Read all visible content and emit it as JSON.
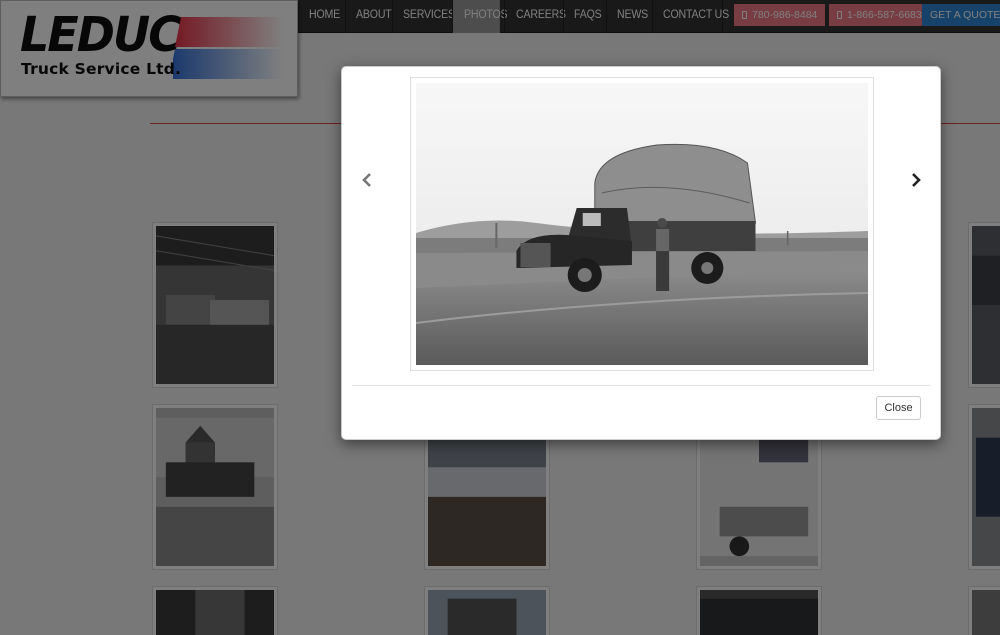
{
  "brand": {
    "logo_word": "LEDUC",
    "logo_sub": "Truck Service Ltd.",
    "stripe_colors": [
      "#e8344a",
      "#2f6fd8"
    ]
  },
  "nav": {
    "items": [
      {
        "label": "HOME",
        "active": false
      },
      {
        "label": "ABOUT",
        "active": false
      },
      {
        "label": "SERVICES",
        "active": false
      },
      {
        "label": "PHOTOS",
        "active": true
      },
      {
        "label": "CAREERS",
        "active": false
      },
      {
        "label": "FAQS",
        "active": false
      },
      {
        "label": "NEWS",
        "active": false
      },
      {
        "label": "CONTACT US",
        "active": false
      }
    ],
    "phone_local": "780-986-8484",
    "phone_tollfree": "1-866-587-6683",
    "quote_label": "GET A QUOTE",
    "phone_icon": "mobile-phone-icon",
    "accent_pink": "#f07a87",
    "accent_blue": "#2f86d4"
  },
  "modal": {
    "image_description": "vintage-truck-photo",
    "prev_icon": "chevron-left-icon",
    "next_icon": "chevron-right-icon",
    "close_label": "Close"
  },
  "gallery": {
    "thumbnails": [
      "garage-interior",
      "vintage-truck-house",
      "trailers-lot",
      "semi-truck-cab",
      "building-dark",
      "city-building",
      "garage-ceiling",
      "truck-side",
      "sign-wall",
      "trailer-rear"
    ]
  }
}
